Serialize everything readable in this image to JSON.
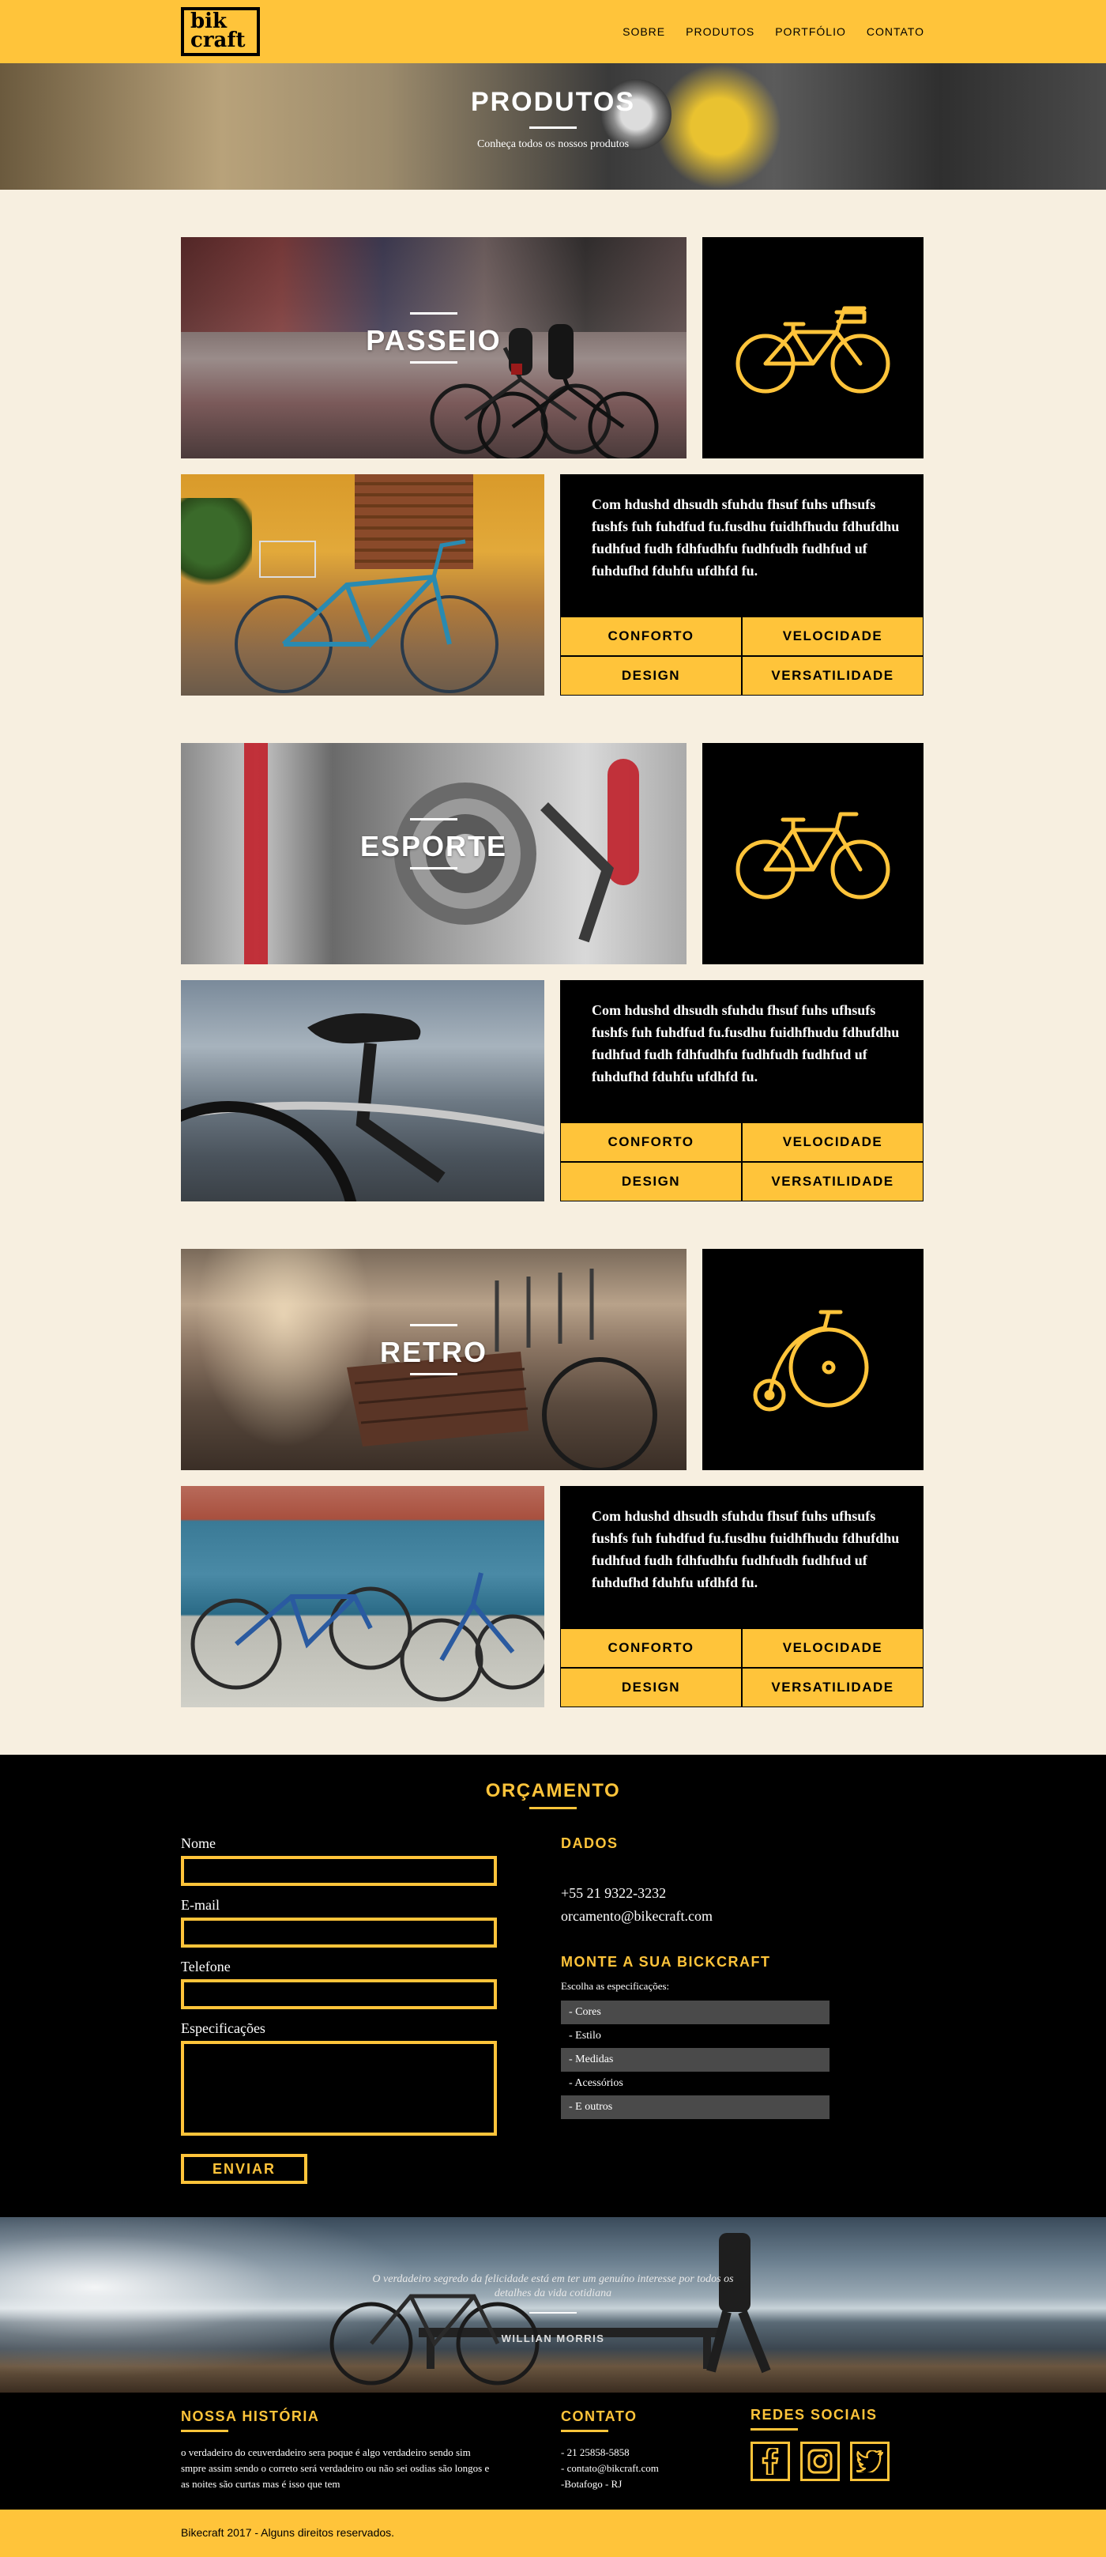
{
  "brand": {
    "logo_line1": "bik",
    "logo_line2": "craft",
    "accent": "#ffc43a"
  },
  "nav": [
    "SOBRE",
    "PRODUTOS",
    "PORTFÓLIO",
    "CONTATO"
  ],
  "hero": {
    "title": "PRODUTOS",
    "subtitle": "Conheça todos os nossos produtos"
  },
  "products": [
    {
      "title": "PASSEIO",
      "icon": "city-bike-icon",
      "description": "Com hdushd dhsudh sfuhdu fhsuf fuhs ufhsufs fushfs fuh fuhdfud fu.fusdhu fuidhfhudu fdhufdhu fudhfud fudh fdhfudhfu fudhfudh fudhfud uf  fuhdufhd fduhfu ufdhfd fu.",
      "features": [
        "CONFORTO",
        "VELOCIDADE",
        "DESIGN",
        "VERSATILIDADE"
      ]
    },
    {
      "title": "ESPORTE",
      "icon": "sport-bike-icon",
      "description": "Com hdushd dhsudh sfuhdu fhsuf fuhs ufhsufs fushfs fuh fuhdfud fu.fusdhu fuidhfhudu fdhufdhu fudhfud fudh fdhfudhfu fudhfudh fudhfud uf  fuhdufhd fduhfu ufdhfd fu.",
      "features": [
        "CONFORTO",
        "VELOCIDADE",
        "DESIGN",
        "VERSATILIDADE"
      ]
    },
    {
      "title": "RETRO",
      "icon": "penny-farthing-icon",
      "description": "Com hdushd dhsudh sfuhdu fhsuf fuhs ufhsufs fushfs fuh fuhdfud fu.fusdhu fuidhfhudu fdhufdhu fudhfud fudh fdhfudhfu fudhfudh fudhfud uf  fuhdufhd fduhfu ufdhfd fu.",
      "features": [
        "CONFORTO",
        "VELOCIDADE",
        "DESIGN",
        "VERSATILIDADE"
      ]
    }
  ],
  "orcamento": {
    "title": "ORÇAMENTO",
    "form": {
      "nome_label": "Nome",
      "email_label": "E-mail",
      "telefone_label": "Telefone",
      "especificacoes_label": "Especificações",
      "submit": "ENVIAR"
    },
    "dados": {
      "title": "DADOS",
      "phone": "+55 21 9322-3232",
      "email": "orcamento@bikecraft.com"
    },
    "monte": {
      "title": "MONTE A SUA BICKCRAFT",
      "intro": "Escolha as especificações:",
      "options": [
        "- Cores",
        "- Estilo",
        "- Medidas",
        "- Acessórios",
        "- E outros"
      ]
    }
  },
  "quote": {
    "text": "O verdadeiro segredo da felicidade está em ter um genuíno interesse por todos os detalhes da vida cotidiana",
    "author": "WILLIAN MORRIS"
  },
  "footer": {
    "historia": {
      "title": "NOSSA HISTÓRIA",
      "text": "o verdadeiro do ceuverdadeiro sera poque é algo verdadeiro sendo sim smpre assim sendo o correto será verdadeiro ou não sei osdias são longos e as noites são curtas mas é isso que tem"
    },
    "contato": {
      "title": "CONTATO",
      "lines": [
        "- 21 25858-5858",
        "- contato@bikcraft.com",
        "-Botafogo - RJ"
      ]
    },
    "redes": {
      "title": "REDES SOCIAIS",
      "icons": [
        "facebook-icon",
        "instagram-icon",
        "twitter-icon"
      ]
    },
    "copyright": "Bikecraft 2017 - Alguns direitos reservados."
  }
}
